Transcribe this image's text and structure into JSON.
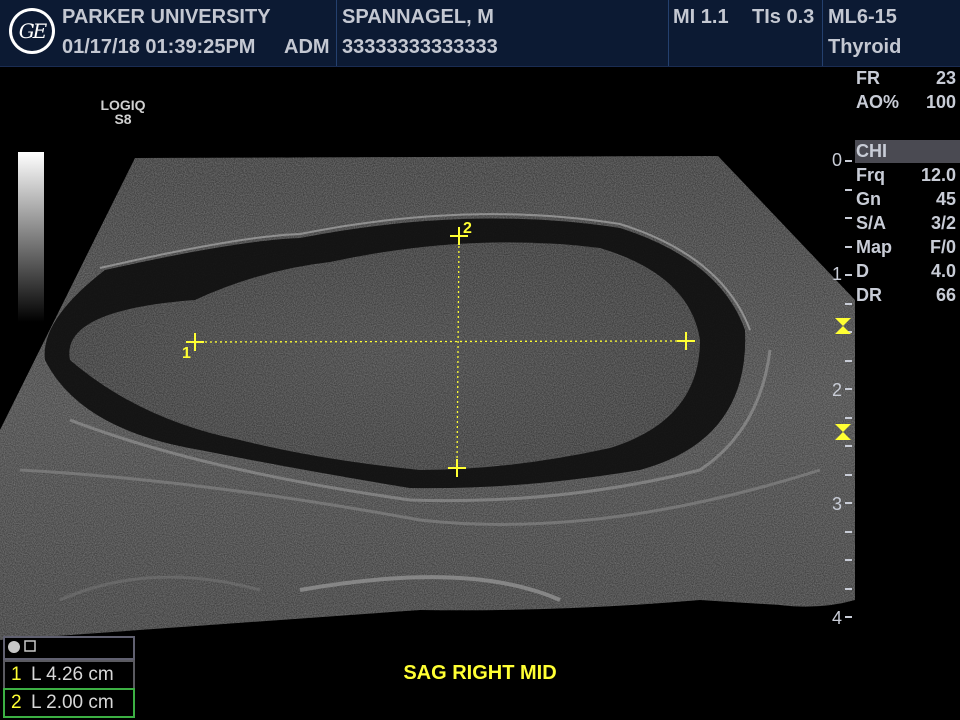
{
  "header": {
    "institution": "PARKER UNIVERSITY",
    "datetime": "01/17/18 01:39:25PM",
    "operator": "ADM",
    "patient_name": "SPANNAGEL, M",
    "patient_id": "33333333333333",
    "mi": "MI 1.1",
    "tis": "TIs 0.3",
    "probe": "ML6-15",
    "preset": "Thyroid",
    "logo": "GE"
  },
  "machine": {
    "line1": "LOGIQ",
    "line2": "S8"
  },
  "params": [
    {
      "label": "FR",
      "value": "23"
    },
    {
      "label": "AO%",
      "value": "100"
    }
  ],
  "chi_label": "CHI",
  "settings": [
    {
      "label": "Frq",
      "value": "12.0"
    },
    {
      "label": "Gn",
      "value": "45"
    },
    {
      "label": "S/A",
      "value": "3/2"
    },
    {
      "label": "Map",
      "value": "F/0"
    },
    {
      "label": "D",
      "value": "4.0"
    },
    {
      "label": "DR",
      "value": "66"
    }
  ],
  "depth_scale": [
    "0",
    "1",
    "2",
    "3",
    "4"
  ],
  "caption": "SAG RIGHT MID",
  "measurements": [
    {
      "index": "1",
      "text": "L  4.26 cm"
    },
    {
      "index": "2",
      "text": "L  2.00 cm"
    }
  ],
  "caliper_labels": [
    "1",
    "2"
  ],
  "colors": {
    "caliper": "#ffff33",
    "header_bg": "#0c1a33",
    "text": "#c8ccd6"
  }
}
